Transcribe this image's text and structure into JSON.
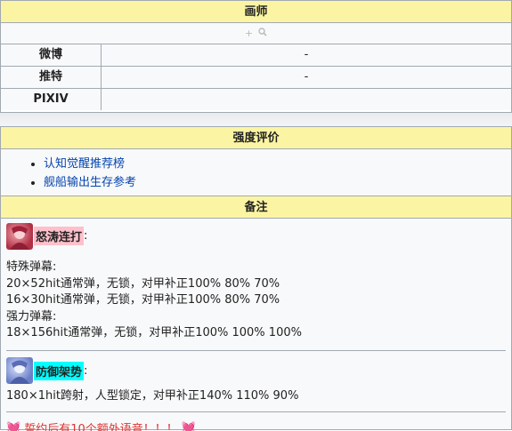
{
  "artist": {
    "header": "画师",
    "rows": [
      {
        "label": "微博",
        "value": "-"
      },
      {
        "label": "推特",
        "value": "-"
      },
      {
        "label": "PIXIV",
        "value": ""
      }
    ]
  },
  "rating": {
    "header": "强度评价",
    "links": [
      "认知觉醒推荐榜",
      "舰船输出生存参考"
    ]
  },
  "notes": {
    "header": "备注",
    "skill1": {
      "name": "怒涛连打",
      "colon": ":",
      "lines": [
        "特殊弹幕:",
        "20×52hit通常弹，无锁，对甲补正100% 80% 70%",
        "16×30hit通常弹，无锁，对甲补正100% 80% 70%",
        "强力弹幕:",
        "18×156hit通常弹，无锁，对甲补正100% 100% 100%"
      ]
    },
    "skill2": {
      "name": "防御架势",
      "colon": ":",
      "lines": [
        "180×1hit跨射，人型锁定，对甲补正140% 110% 90%"
      ]
    },
    "footer": "誓约后有10个额外语音！！！",
    "heart": "💓"
  },
  "colors": {
    "header_bg": "#fbf5a3",
    "link": "#0645ad",
    "footer_text": "#dd3333"
  }
}
